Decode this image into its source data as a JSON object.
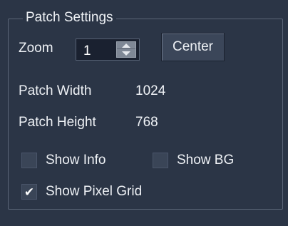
{
  "group": {
    "title": "Patch Settings"
  },
  "zoom": {
    "label": "Zoom",
    "value": "1"
  },
  "center_button": {
    "label": "Center"
  },
  "patch_width": {
    "label": "Patch Width",
    "value": "1024"
  },
  "patch_height": {
    "label": "Patch Height",
    "value": "768"
  },
  "checkboxes": {
    "show_info": {
      "label": "Show Info",
      "checked": false
    },
    "show_bg": {
      "label": "Show BG",
      "checked": false
    },
    "show_pixel_grid": {
      "label": "Show Pixel Grid",
      "checked": true,
      "mark": "✔"
    }
  },
  "colors": {
    "panel_background": "#2b3546",
    "input_background": "#1a2130",
    "button_background": "#3b4659",
    "text": "#eef1f5"
  }
}
